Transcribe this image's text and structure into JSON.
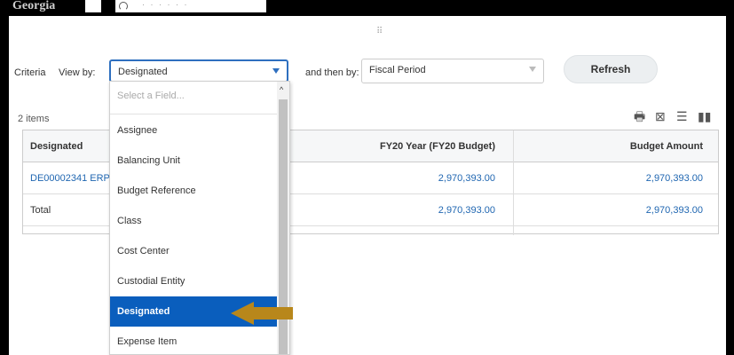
{
  "header": {
    "brand": "Georgia"
  },
  "criteria": {
    "label": "Criteria",
    "view_by_label": "View by:",
    "view_by_value": "Designated",
    "then_by_label": "and then by:",
    "then_by_value": "Fiscal Period",
    "refresh_label": "Refresh"
  },
  "results": {
    "count": "2 items",
    "columns": [
      "Designated",
      "FY20 Year (FY20 Budget)",
      "Budget Amount"
    ],
    "rows": [
      {
        "designated": "DE00002341 ERP",
        "fy20": "2,970,393.00",
        "budget": "2,970,393.00"
      },
      {
        "designated": "Total",
        "fy20": "2,970,393.00",
        "budget": "2,970,393.00"
      }
    ]
  },
  "dropdown": {
    "placeholder": "Select a Field...",
    "items": [
      "Assignee",
      "Balancing Unit",
      "Budget Reference",
      "Class",
      "Cost Center",
      "Custodial Entity",
      "Designated",
      "Expense Item"
    ],
    "selected": "Designated"
  },
  "colors": {
    "accent": "#0a5ebd",
    "link": "#1f66b1",
    "annotation_arrow": "#b8871b"
  }
}
